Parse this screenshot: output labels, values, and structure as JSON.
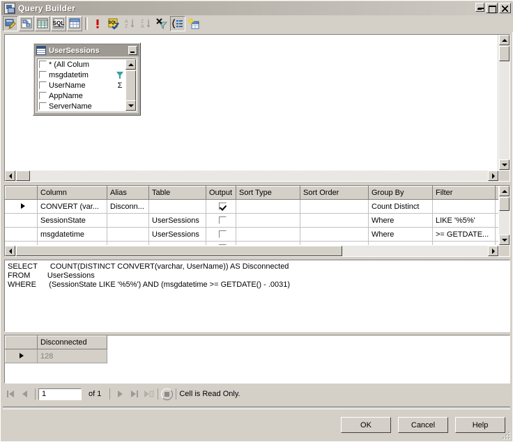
{
  "window": {
    "title": "Query Builder",
    "icon": "query-builder-icon",
    "minimize_label": "Minimize",
    "maximize_label": "Maximize",
    "close_label": "Close"
  },
  "toolbar": {
    "buttons": [
      {
        "name": "edit-in-sql-icon",
        "label": "Edit"
      },
      {
        "name": "show-diagram-pane-icon",
        "label": "Diagram Pane"
      },
      {
        "name": "show-grid-pane-icon",
        "label": "Grid Pane"
      },
      {
        "name": "show-sql-pane-icon",
        "label": "SQL Pane"
      },
      {
        "name": "show-results-pane-icon",
        "label": "Results Pane"
      },
      {
        "name": "run-query-icon",
        "label": "Run"
      },
      {
        "name": "verify-sql-icon",
        "label": "Verify SQL Syntax"
      },
      {
        "name": "sort-ascending-icon",
        "label": "Sort Ascending"
      },
      {
        "name": "sort-descending-icon",
        "label": "Sort Descending"
      },
      {
        "name": "remove-filter-icon",
        "label": "Remove Filter"
      },
      {
        "name": "group-by-icon",
        "label": "Use Group By"
      },
      {
        "name": "add-table-icon",
        "label": "Add Table"
      }
    ]
  },
  "diagram": {
    "table": {
      "name": "UserSessions",
      "minimize_label": "Minimize",
      "columns": [
        {
          "label": "* (All Colum",
          "checked": false,
          "badge": ""
        },
        {
          "label": "msgdatetim",
          "checked": false,
          "badge": "filter"
        },
        {
          "label": "UserName",
          "checked": false,
          "badge": "Σ"
        },
        {
          "label": "AppName",
          "checked": false,
          "badge": ""
        },
        {
          "label": "ServerName",
          "checked": false,
          "badge": ""
        }
      ]
    }
  },
  "grid": {
    "headers": [
      "",
      "Column",
      "Alias",
      "Table",
      "Output",
      "Sort Type",
      "Sort Order",
      "Group By",
      "Filter",
      "O"
    ],
    "rows": [
      {
        "selected": true,
        "column": "CONVERT (var...",
        "alias": "Disconn...",
        "table": "",
        "output": true,
        "sort_type": "",
        "sort_order": "",
        "group_by": "Count Distinct",
        "filter": "",
        "or": ""
      },
      {
        "selected": false,
        "column": "SessionState",
        "alias": "",
        "table": "UserSessions",
        "output": false,
        "sort_type": "",
        "sort_order": "",
        "group_by": "Where",
        "filter": "LIKE '%5%'",
        "or": ""
      },
      {
        "selected": false,
        "column": "msgdatetime",
        "alias": "",
        "table": "UserSessions",
        "output": false,
        "sort_type": "",
        "sort_order": "",
        "group_by": "Where",
        "filter": ">= GETDATE...",
        "or": ""
      },
      {
        "selected": false,
        "column": "",
        "alias": "",
        "table": "",
        "output": false,
        "sort_type": "",
        "sort_order": "",
        "group_by": "",
        "filter": "",
        "or": ""
      }
    ]
  },
  "sql": {
    "lines": [
      "SELECT      COUNT(DISTINCT CONVERT(varchar, UserName)) AS Disconnected",
      "FROM        UserSessions",
      "WHERE      (SessionState LIKE '%5%') AND (msgdatetime >= GETDATE() - .0031)"
    ]
  },
  "results": {
    "headers": [
      "Disconnected"
    ],
    "rows": [
      {
        "selected": true,
        "values": [
          "128"
        ]
      }
    ]
  },
  "navigation": {
    "first_label": "First",
    "previous_label": "Previous",
    "page_value": "1",
    "of_text": "of 1",
    "next_label": "Next",
    "last_label": "Last",
    "new_label": "New",
    "stop_label": "Stop",
    "status": "Cell is Read Only."
  },
  "footer": {
    "ok_label": "OK",
    "cancel_label": "Cancel",
    "help_label": "Help"
  },
  "colors": {
    "face": "#d4d0c8",
    "title_start": "#a8a49c",
    "title_end": "#cfcbc4",
    "table_header": "#9e9a93",
    "teal_icon": "#39a0a0",
    "readonly_text": "#808080"
  }
}
